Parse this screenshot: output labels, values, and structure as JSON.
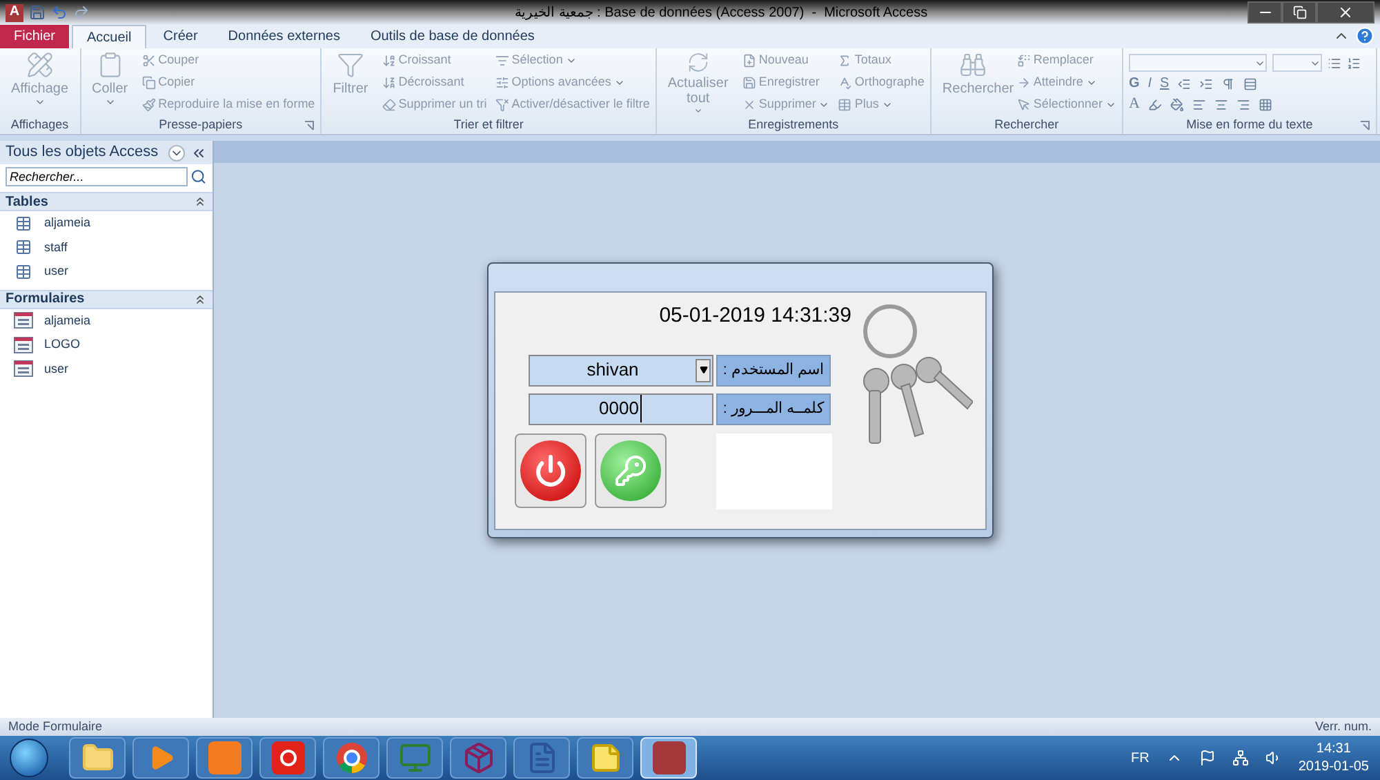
{
  "window": {
    "logo": "A",
    "title": "جمعية الخيرية : Base de données (Access 2007)  -  Microsoft Access"
  },
  "tabs": [
    {
      "label": "Fichier",
      "kind": "file",
      "selected": false
    },
    {
      "label": "Accueil",
      "kind": "tab",
      "selected": true
    },
    {
      "label": "Créer",
      "kind": "tab",
      "selected": false
    },
    {
      "label": "Données externes",
      "kind": "tab",
      "selected": false
    },
    {
      "label": "Outils de base de données",
      "kind": "tab",
      "selected": false
    }
  ],
  "ribbon": {
    "groups": [
      {
        "label": "Affichages",
        "launcher": false,
        "large": [
          {
            "label": "Affichage",
            "menu": true,
            "disabled": true
          }
        ]
      },
      {
        "label": "Presse-papiers",
        "launcher": true,
        "large": [
          {
            "label": "Coller",
            "menu": true,
            "disabled": true
          }
        ],
        "columns": [
          [
            {
              "label": "Couper",
              "menu": false,
              "disabled": true
            },
            {
              "label": "Copier",
              "menu": false,
              "disabled": true
            },
            {
              "label": "Reproduire la mise en forme",
              "menu": false,
              "disabled": true
            }
          ]
        ]
      },
      {
        "label": "Trier et filtrer",
        "launcher": false,
        "large": [
          {
            "label": "Filtrer",
            "menu": false,
            "disabled": true
          }
        ],
        "columns": [
          [
            {
              "label": "Croissant",
              "menu": false,
              "disabled": true
            },
            {
              "label": "Décroissant",
              "menu": false,
              "disabled": true
            },
            {
              "label": "Supprimer un tri",
              "menu": false,
              "disabled": true
            }
          ],
          [
            {
              "label": "Sélection",
              "menu": true,
              "disabled": true
            },
            {
              "label": "Options avancées",
              "menu": true,
              "disabled": true
            },
            {
              "label": "Activer/désactiver le filtre",
              "menu": false,
              "disabled": true
            }
          ]
        ]
      },
      {
        "label": "Enregistrements",
        "launcher": false,
        "large": [
          {
            "label": "Actualiser tout",
            "menu": true,
            "disabled": true
          }
        ],
        "columns": [
          [
            {
              "label": "Nouveau",
              "menu": false,
              "disabled": true
            },
            {
              "label": "Enregistrer",
              "menu": false,
              "disabled": true
            },
            {
              "label": "Supprimer",
              "menu": true,
              "disabled": true
            }
          ],
          [
            {
              "label": "Totaux",
              "menu": false,
              "disabled": true
            },
            {
              "label": "Orthographe",
              "menu": false,
              "disabled": true
            },
            {
              "label": "Plus",
              "menu": true,
              "disabled": true
            }
          ]
        ]
      },
      {
        "label": "Rechercher",
        "launcher": false,
        "large": [
          {
            "label": "Rechercher",
            "menu": false,
            "disabled": true
          }
        ],
        "columns": [
          [
            {
              "label": "Remplacer",
              "menu": false,
              "disabled": true
            },
            {
              "label": "Atteindre",
              "menu": true,
              "disabled": true
            },
            {
              "label": "Sélectionner",
              "menu": true,
              "disabled": true
            }
          ]
        ]
      }
    ],
    "format_group": {
      "label": "Mise en forme du texte",
      "style_letters": [
        "G",
        "I",
        "S"
      ],
      "color_letter": "A"
    }
  },
  "nav_pane": {
    "title": "Tous les objets Access",
    "search": {
      "placeholder": "Rechercher..."
    },
    "sections": [
      {
        "title": "Tables",
        "expanded": true,
        "items": [
          {
            "label": "aljameia",
            "kind": "table"
          },
          {
            "label": "staff",
            "kind": "table"
          },
          {
            "label": "user",
            "kind": "table"
          }
        ]
      },
      {
        "title": "Formulaires",
        "expanded": true,
        "items": [
          {
            "label": "aljameia",
            "kind": "form"
          },
          {
            "label": "LOGO",
            "kind": "form"
          },
          {
            "label": "user",
            "kind": "form"
          }
        ]
      }
    ]
  },
  "login_form": {
    "datetime": "05-01-2019 14:31:39",
    "username": {
      "label": "اسم المستخدم :",
      "value": "shivan"
    },
    "password": {
      "label": "كلمــه المـــرور :",
      "value": "0000"
    }
  },
  "status_bar": {
    "mode": "Mode Formulaire",
    "indicator": "Verr. num."
  },
  "taskbar": {
    "apps": [
      {
        "selected": false
      },
      {
        "selected": false
      },
      {
        "selected": false
      },
      {
        "selected": false
      },
      {
        "selected": false
      },
      {
        "selected": false
      },
      {
        "selected": false
      },
      {
        "selected": false
      },
      {
        "selected": false
      },
      {
        "selected": true
      }
    ],
    "language": "FR",
    "time": "14:31",
    "date": "2019-01-05"
  }
}
